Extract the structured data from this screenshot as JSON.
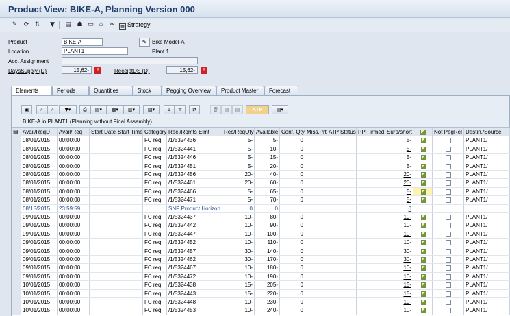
{
  "title": "Product View: BIKE-A, Planning Version 000",
  "toolbar": {
    "strategy_label": "Strategy"
  },
  "header": {
    "product_label": "Product",
    "product_value": "BIKE-A",
    "product_desc": "Bike Model-A",
    "location_label": "Location",
    "location_value": "PLANT1",
    "location_desc": "Plant 1",
    "acct_label": "Acct Assignment",
    "days_supply_label": "DaysSupply (D)",
    "days_supply_value": "15,62-",
    "receipt_ds_label": "ReceiptDS (D)",
    "receipt_ds_value": "15,62-"
  },
  "tabs": [
    "Elements",
    "Periods",
    "Quantities",
    "Stock",
    "Pegging Overview",
    "Product Master",
    "Forecast"
  ],
  "grid_toolbar": {
    "atp_label": "ATP"
  },
  "grid_title": "BIKE-A in PLANT1 (Planning without Final Assembly)",
  "columns": [
    "Avail/ReqD",
    "Avail/ReqT",
    "Start Date",
    "Start Time",
    "Category",
    "Rec./Rqmts Elmt",
    "Rec/ReqQty",
    "Available",
    "Conf. Qty.",
    "Miss.Prt",
    "ATP Status",
    "PP-Firmed",
    "Surp/short",
    "",
    "Not PegRel",
    "Destin./Source"
  ],
  "rows": [
    {
      "date": "08/01/2015",
      "time": "00:00:00",
      "cat": "FC req.",
      "elmt": "/1/5324436",
      "qty": "5-",
      "avail": "5-",
      "conf": "0",
      "surp": "5-",
      "dest": "PLANT1/"
    },
    {
      "date": "08/01/2015",
      "time": "00:00:00",
      "cat": "FC req.",
      "elmt": "/1/5324441",
      "qty": "5-",
      "avail": "10-",
      "conf": "0",
      "surp": "5-",
      "dest": "PLANT1/"
    },
    {
      "date": "08/01/2015",
      "time": "00:00:00",
      "cat": "FC req.",
      "elmt": "/1/5324446",
      "qty": "5-",
      "avail": "15-",
      "conf": "0",
      "surp": "5-",
      "dest": "PLANT1/"
    },
    {
      "date": "08/01/2015",
      "time": "00:00:00",
      "cat": "FC req.",
      "elmt": "/1/5324451",
      "qty": "5-",
      "avail": "20-",
      "conf": "0",
      "surp": "5-",
      "dest": "PLANT1/"
    },
    {
      "date": "08/01/2015",
      "time": "00:00:00",
      "cat": "FC req.",
      "elmt": "/1/5324456",
      "qty": "20-",
      "avail": "40-",
      "conf": "0",
      "surp": "20-",
      "dest": "PLANT1/"
    },
    {
      "date": "08/01/2015",
      "time": "00:00:00",
      "cat": "FC req.",
      "elmt": "/1/5324461",
      "qty": "20-",
      "avail": "60-",
      "conf": "0",
      "surp": "20-",
      "dest": "PLANT1/"
    },
    {
      "date": "08/01/2015",
      "time": "00:00:00",
      "cat": "FC req.",
      "elmt": "/1/5324466",
      "qty": "5-",
      "avail": "65-",
      "conf": "0",
      "surp": "5-",
      "dest": "PLANT1/",
      "hl": true
    },
    {
      "date": "08/01/2015",
      "time": "00:00:00",
      "cat": "FC req.",
      "elmt": "/1/5324471",
      "qty": "5-",
      "avail": "70-",
      "conf": "0",
      "surp": "5-",
      "dest": "PLANT1/"
    },
    {
      "date": "08/15/2015",
      "time": "23:59:59",
      "cat": "",
      "elmt": "SNP Product Horizon",
      "qty": "0",
      "avail": "0",
      "conf": "",
      "surp": "0",
      "dest": "",
      "horizon": true
    },
    {
      "date": "09/01/2015",
      "time": "00:00:00",
      "cat": "FC req.",
      "elmt": "/1/5324437",
      "qty": "10-",
      "avail": "80-",
      "conf": "0",
      "surp": "10-",
      "dest": "PLANT1/"
    },
    {
      "date": "09/01/2015",
      "time": "00:00:00",
      "cat": "FC req.",
      "elmt": "/1/5324442",
      "qty": "10-",
      "avail": "90-",
      "conf": "0",
      "surp": "10-",
      "dest": "PLANT1/"
    },
    {
      "date": "09/01/2015",
      "time": "00:00:00",
      "cat": "FC req.",
      "elmt": "/1/5324447",
      "qty": "10-",
      "avail": "100-",
      "conf": "0",
      "surp": "10-",
      "dest": "PLANT1/"
    },
    {
      "date": "09/01/2015",
      "time": "00:00:00",
      "cat": "FC req.",
      "elmt": "/1/5324452",
      "qty": "10-",
      "avail": "110-",
      "conf": "0",
      "surp": "10-",
      "dest": "PLANT1/"
    },
    {
      "date": "09/01/2015",
      "time": "00:00:00",
      "cat": "FC req.",
      "elmt": "/1/5324457",
      "qty": "30-",
      "avail": "140-",
      "conf": "0",
      "surp": "30-",
      "dest": "PLANT1/"
    },
    {
      "date": "09/01/2015",
      "time": "00:00:00",
      "cat": "FC req.",
      "elmt": "/1/5324462",
      "qty": "30-",
      "avail": "170-",
      "conf": "0",
      "surp": "30-",
      "dest": "PLANT1/"
    },
    {
      "date": "09/01/2015",
      "time": "00:00:00",
      "cat": "FC req.",
      "elmt": "/1/5324467",
      "qty": "10-",
      "avail": "180-",
      "conf": "0",
      "surp": "10-",
      "dest": "PLANT1/"
    },
    {
      "date": "09/01/2015",
      "time": "00:00:00",
      "cat": "FC req.",
      "elmt": "/1/5324472",
      "qty": "10-",
      "avail": "190-",
      "conf": "0",
      "surp": "10-",
      "dest": "PLANT1/"
    },
    {
      "date": "10/01/2015",
      "time": "00:00:00",
      "cat": "FC req.",
      "elmt": "/1/5324438",
      "qty": "15-",
      "avail": "205-",
      "conf": "0",
      "surp": "15-",
      "dest": "PLANT1/"
    },
    {
      "date": "10/01/2015",
      "time": "00:00:00",
      "cat": "FC req.",
      "elmt": "/1/5324443",
      "qty": "15-",
      "avail": "220-",
      "conf": "0",
      "surp": "15-",
      "dest": "PLANT1/"
    },
    {
      "date": "10/01/2015",
      "time": "00:00:00",
      "cat": "FC req.",
      "elmt": "/1/5324448",
      "qty": "10-",
      "avail": "230-",
      "conf": "0",
      "surp": "10-",
      "dest": "PLANT1/"
    },
    {
      "date": "10/01/2015",
      "time": "00:00:00",
      "cat": "FC req.",
      "elmt": "/1/5324453",
      "qty": "10-",
      "avail": "240-",
      "conf": "0",
      "surp": "10-",
      "dest": "PLANT1/"
    }
  ]
}
